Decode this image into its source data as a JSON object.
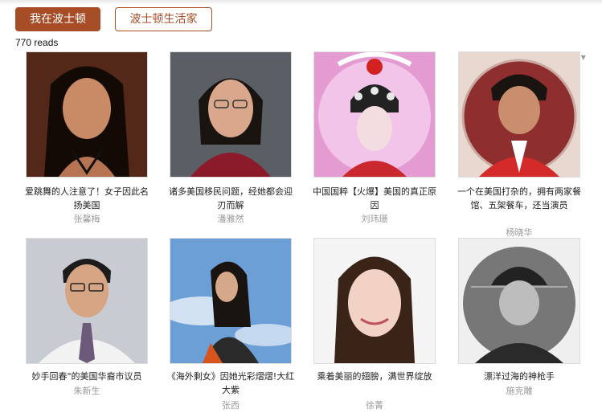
{
  "tabs": [
    {
      "label": "我在波士顿",
      "active": true
    },
    {
      "label": "波士顿生活家",
      "active": false
    }
  ],
  "reads": "770 reads",
  "accent_color": "#a64d27",
  "settings_icon": "gear-icon",
  "cards": [
    {
      "caption": "爱跳舞的人注意了！女子因此名扬美国",
      "author": "张馨梅"
    },
    {
      "caption": "诸多美国移民问题，经她都会迎刃而解",
      "author": "潘雅然"
    },
    {
      "caption": "中国国粹【火爆】美国的真正原因",
      "author": "刘玮珊"
    },
    {
      "caption": "一个在美国打杂的，拥有两家餐馆、五架餐车，还当演员",
      "author": "杨晓华"
    },
    {
      "caption": "妙手回春\"的美国华裔市议员",
      "author": "朱新生"
    },
    {
      "caption": "《海外剩女》因她光彩熠熠!大红大紫",
      "author": "张西"
    },
    {
      "caption": "乘着美丽的翅膀，满世界绽放",
      "author": "徐菁"
    },
    {
      "caption": "漂洋过海的神枪手",
      "author": "施克雕"
    }
  ]
}
